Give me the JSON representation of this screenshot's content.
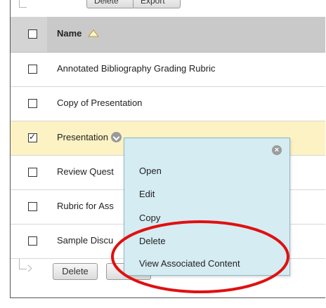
{
  "top_toolbar": {
    "delete_label": "Delete",
    "export_label": "Export"
  },
  "table": {
    "header": {
      "name_label": "Name"
    },
    "rows": [
      {
        "name": "Annotated Bibliography Grading Rubric",
        "checked": false
      },
      {
        "name": "Copy of Presentation",
        "checked": false
      },
      {
        "name": "Presentation",
        "checked": true
      },
      {
        "name": "Review Quest",
        "checked": false
      },
      {
        "name": "Rubric for Ass",
        "checked": false
      },
      {
        "name": "Sample Discu",
        "checked": false
      }
    ]
  },
  "bottom_toolbar": {
    "delete_label": "Delete",
    "export_label": "Ex"
  },
  "context_menu": {
    "items": [
      "Open",
      "Edit",
      "Copy",
      "Delete",
      "View Associated Content"
    ]
  },
  "colors": {
    "selected_row": "#fdf2c4",
    "menu_bg": "#d4ecf2",
    "highlight_ring": "#e01010"
  },
  "checkmark": "✓"
}
